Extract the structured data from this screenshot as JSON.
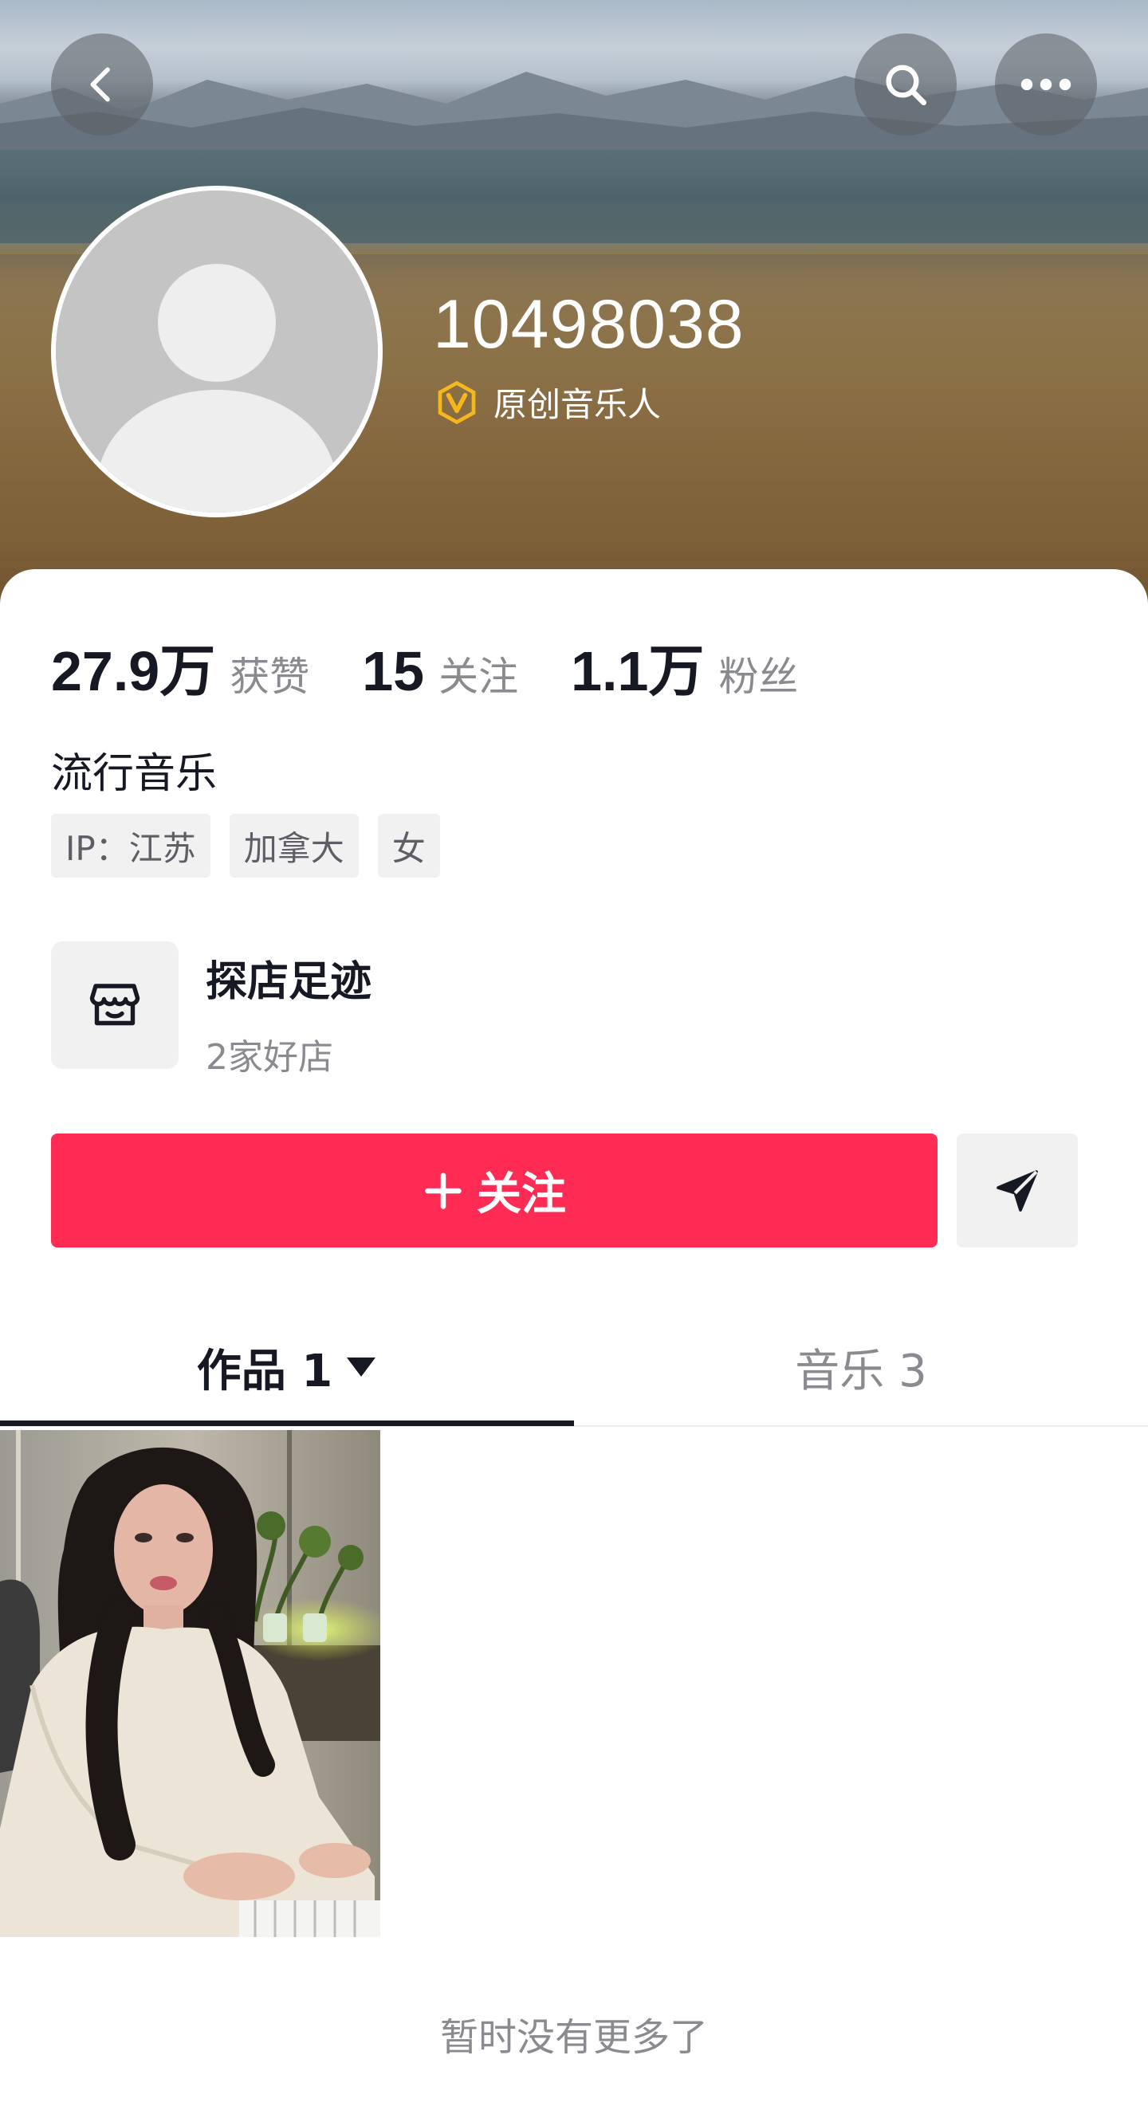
{
  "header": {
    "back_icon": "chevron-left-icon",
    "search_icon": "search-icon",
    "more_icon": "more-horizontal-icon"
  },
  "profile": {
    "username": "10498038",
    "verified_label": "原创音乐人",
    "verified_color": "#f5b81c"
  },
  "stats": [
    {
      "value": "27.9万",
      "label": "获赞"
    },
    {
      "value": "15",
      "label": "关注"
    },
    {
      "value": "1.1万",
      "label": "粉丝"
    }
  ],
  "bio": "流行音乐",
  "tags": [
    "IP：江苏",
    "加拿大",
    "女"
  ],
  "shop": {
    "title": "探店足迹",
    "subtitle": "2家好店",
    "icon": "store-icon"
  },
  "actions": {
    "follow_label": "关注",
    "follow_color": "#fe2c55",
    "share_icon": "send-icon"
  },
  "tabs": [
    {
      "label": "作品 1",
      "active": true
    },
    {
      "label": "音乐 3",
      "active": false
    }
  ],
  "footer_note": "暂时没有更多了"
}
